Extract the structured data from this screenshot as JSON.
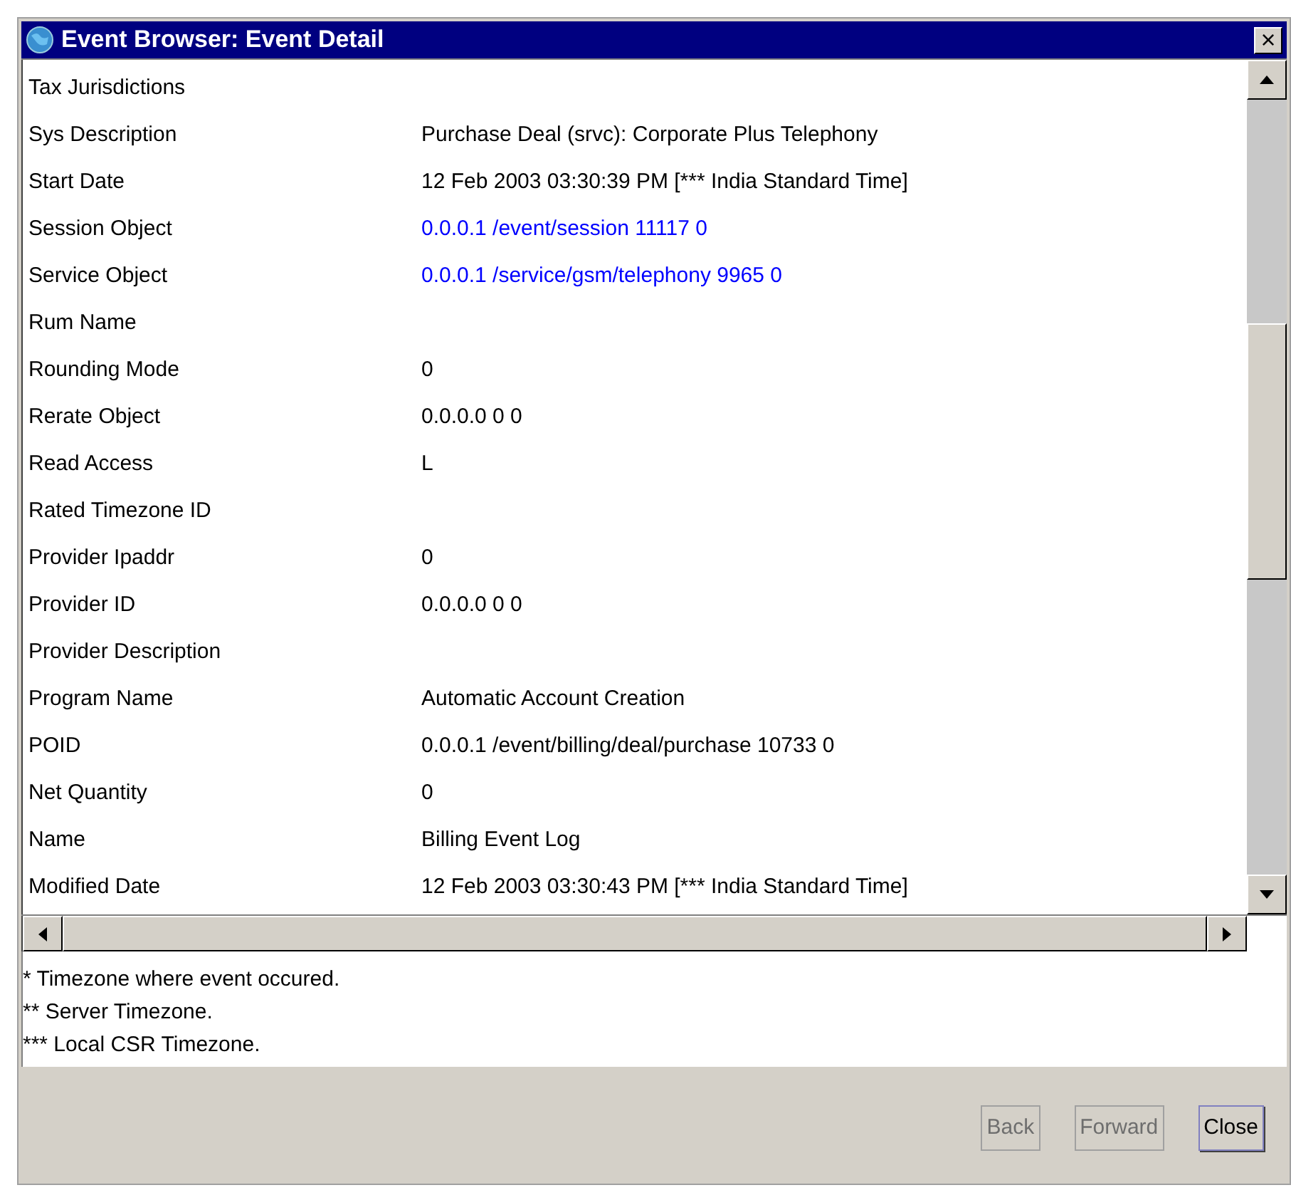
{
  "window": {
    "title": "Event Browser: Event Detail",
    "close_glyph": "×"
  },
  "rows": [
    {
      "label": "Tax Jurisdictions",
      "value": "",
      "kind": "text"
    },
    {
      "label": "Sys Description",
      "value": "Purchase Deal (srvc): Corporate Plus Telephony",
      "kind": "text"
    },
    {
      "label": "Start Date",
      "value": "12 Feb 2003 03:30:39 PM [*** India Standard Time]",
      "kind": "text"
    },
    {
      "label": "Session Object",
      "value": "0.0.0.1 /event/session 11117 0",
      "kind": "link"
    },
    {
      "label": "Service Object",
      "value": "0.0.0.1 /service/gsm/telephony 9965 0",
      "kind": "link"
    },
    {
      "label": "Rum Name",
      "value": "",
      "kind": "text"
    },
    {
      "label": "Rounding Mode",
      "value": "0",
      "kind": "text"
    },
    {
      "label": "Rerate Object",
      "value": "0.0.0.0  0 0",
      "kind": "text"
    },
    {
      "label": "Read Access",
      "value": "L",
      "kind": "text"
    },
    {
      "label": "Rated Timezone ID",
      "value": "",
      "kind": "text"
    },
    {
      "label": "Provider Ipaddr",
      "value": "0",
      "kind": "text"
    },
    {
      "label": "Provider ID",
      "value": "0.0.0.0  0 0",
      "kind": "text"
    },
    {
      "label": "Provider Description",
      "value": "",
      "kind": "text"
    },
    {
      "label": "Program Name",
      "value": "Automatic Account Creation",
      "kind": "text"
    },
    {
      "label": "POID",
      "value": "0.0.0.1 /event/billing/deal/purchase 10733 0",
      "kind": "text"
    },
    {
      "label": "Net Quantity",
      "value": "0",
      "kind": "text"
    },
    {
      "label": "Name",
      "value": "Billing Event Log",
      "kind": "text"
    },
    {
      "label": "Modified Date",
      "value": "12 Feb 2003 03:30:43 PM [*** India Standard Time]",
      "kind": "text"
    }
  ],
  "notes": [
    "* Timezone where event occured.",
    "** Server Timezone.",
    "*** Local CSR Timezone."
  ],
  "buttons": [
    {
      "label": "Back",
      "disabled": true
    },
    {
      "label": "Forward",
      "disabled": true
    },
    {
      "label": "Close",
      "disabled": false
    }
  ]
}
